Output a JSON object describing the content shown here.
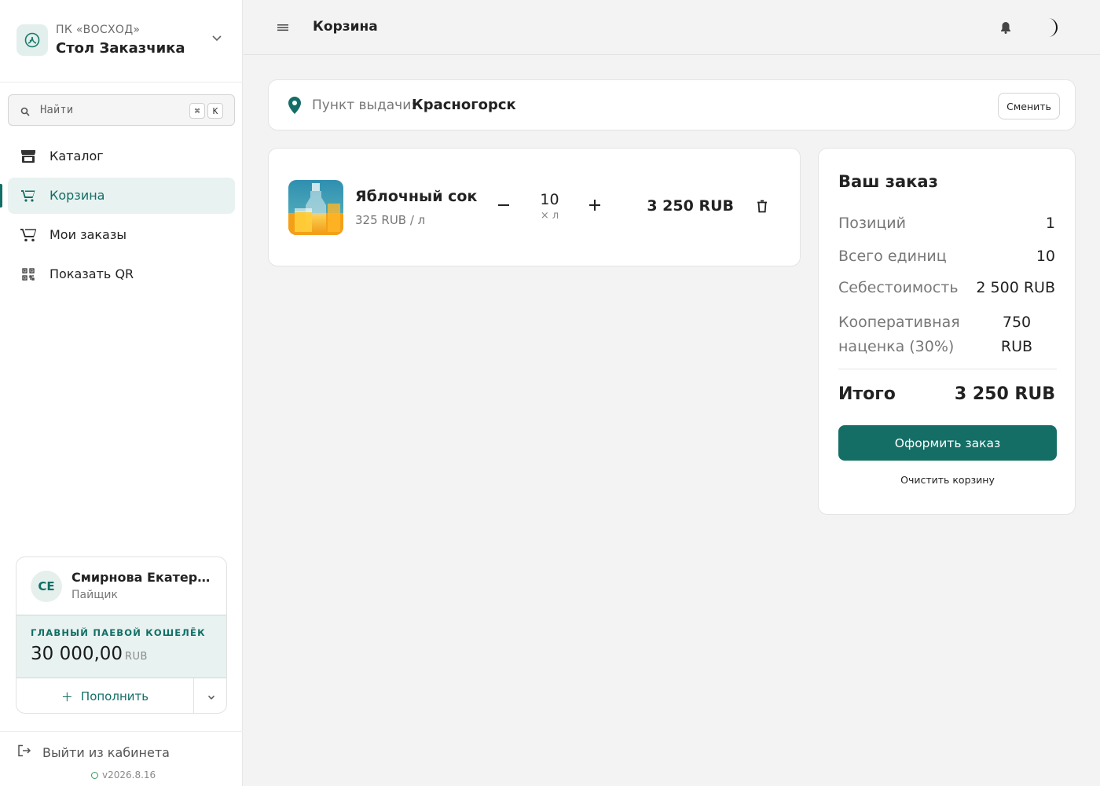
{
  "org": {
    "subtitle": "ПК «ВОСХОД»",
    "title": "Стол Заказчика"
  },
  "search": {
    "placeholder": "Найти",
    "kbd1": "⌘",
    "kbd2": "K"
  },
  "nav": {
    "items": [
      {
        "label": "Каталог",
        "icon": "store-icon"
      },
      {
        "label": "Корзина",
        "icon": "cart-icon",
        "active": true
      },
      {
        "label": "Мои заказы",
        "icon": "cart-icon"
      },
      {
        "label": "Показать QR",
        "icon": "qr-icon"
      }
    ]
  },
  "user": {
    "initials": "СЕ",
    "name": "Смирнова Екатерина",
    "role": "Пайщик",
    "wallet_label": "ГЛАВНЫЙ ПАЕВОЙ КОШЕЛЁК",
    "wallet_amount": "30 000,00",
    "wallet_currency": "RUB",
    "topup_label": "Пополнить"
  },
  "footer": {
    "logout_label": "Выйти из кабинета",
    "version": "v2026.8.16"
  },
  "topbar": {
    "title": "Корзина"
  },
  "pickup": {
    "label": "Пункт выдачи:",
    "city": "Красногорск",
    "change_label": "Сменить"
  },
  "cart": {
    "items": [
      {
        "name": "Яблочный сок",
        "price": "325 RUB / л",
        "qty": "10",
        "unit": "× л",
        "total": "3 250 RUB"
      }
    ]
  },
  "summary": {
    "title": "Ваш заказ",
    "rows": [
      {
        "label": "Позиций",
        "value": "1"
      },
      {
        "label": "Всего единиц",
        "value": "10"
      },
      {
        "label": "Себестоимость",
        "value": "2 500 RUB"
      },
      {
        "label": "Кооперативная наценка (30%)",
        "value": "750 RUB"
      }
    ],
    "total_label": "Итого",
    "total_value": "3 250 RUB",
    "checkout_label": "Оформить заказ",
    "clear_label": "Очистить корзину"
  },
  "colors": {
    "accent": "#126f65",
    "accent_light": "#e8f2f0",
    "button": "#146e66"
  }
}
